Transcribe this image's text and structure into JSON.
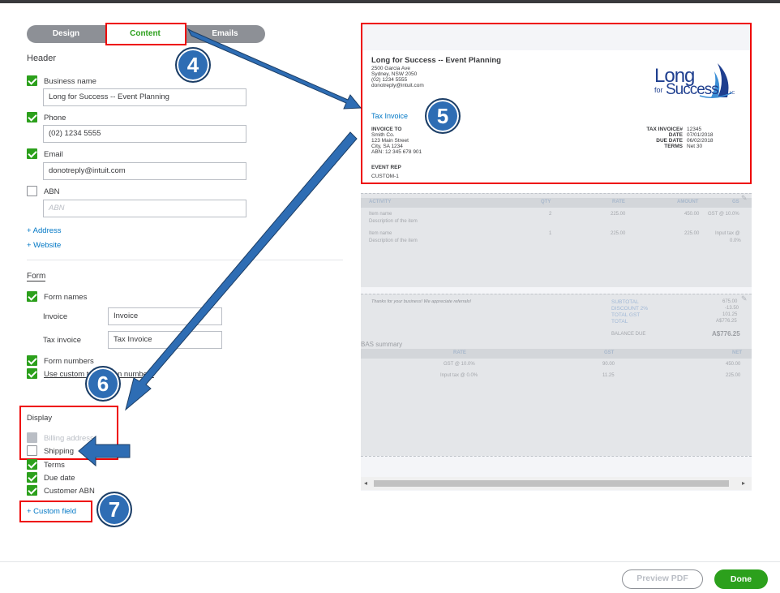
{
  "tabs": {
    "design": "Design",
    "content": "Content",
    "emails": "Emails"
  },
  "header_section": {
    "title": "Header",
    "business_name_label": "Business name",
    "business_name_value": "Long for Success --  Event Planning",
    "phone_label": "Phone",
    "phone_value": "(02) 1234 5555",
    "email_label": "Email",
    "email_value": "donotreply@intuit.com",
    "abn_label": "ABN",
    "abn_placeholder": "ABN",
    "add_address": "+ Address",
    "add_website": "+ Website"
  },
  "form_section": {
    "title": "Form",
    "form_names_label": "Form names",
    "invoice_label": "Invoice",
    "invoice_value": "Invoice",
    "tax_invoice_label": "Tax invoice",
    "tax_invoice_value": "Tax Invoice",
    "form_numbers_label": "Form numbers",
    "custom_numbers_label": "Use custom tr",
    "custom_numbers_label_tail": "n numbers"
  },
  "display_section": {
    "title": "Display",
    "billing_address": "Billing address",
    "shipping": "Shipping",
    "terms": "Terms",
    "due_date": "Due date",
    "customer_abn": "Customer ABN",
    "custom_field": "+ Custom field"
  },
  "callouts": [
    "4",
    "5",
    "6",
    "7"
  ],
  "preview": {
    "company": "Long for Success -- Event Planning",
    "address1": "2500 Garcia Ave",
    "address2": "Sydney, NSW 2050",
    "phone": "(02) 1234 5555",
    "email": "donotreply@intuit.com",
    "logo_long": "Long",
    "logo_for": "for",
    "logo_success": "Success",
    "logo_llc": "LLC",
    "doc_title": "Tax Invoice",
    "invoice_to": "INVOICE TO",
    "to_lines": [
      "Smith Co.",
      "123 Main Street",
      "City, SA 1234",
      "ABN: 12 345 678 901"
    ],
    "meta_labels": [
      "TAX INVOICE#",
      "DATE",
      "DUE DATE",
      "TERMS"
    ],
    "meta_values": [
      "12345",
      "07/01/2018",
      "06/02/2018",
      "Net 30"
    ],
    "event_rep": "EVENT REP",
    "custom1": "CUSTOM-1",
    "table_headers": [
      "ACTIVITY",
      "QTY",
      "RATE",
      "AMOUNT",
      "GS"
    ],
    "row1": {
      "name": "Item name",
      "desc": "Description of the item",
      "qty": "2",
      "rate": "225.00",
      "amount": "450.00",
      "gst": "GST @ 10.0%"
    },
    "row2": {
      "name": "Item name",
      "desc": "Description of the item",
      "qty": "1",
      "rate": "225.00",
      "amount": "225.00",
      "gst": "Input tax @",
      "gst2": "0.0%"
    },
    "thanks": "Thanks for your business! We appreciate referrals!",
    "totals_labels": [
      "SUBTOTAL",
      "DISCOUNT 2%",
      "TOTAL GST",
      "TOTAL"
    ],
    "totals_values": [
      "675.00",
      "-13.50",
      "101.25",
      "A$776.25"
    ],
    "balance_label": "BALANCE DUE",
    "balance_value": "A$776.25",
    "bas_title": "BAS summary",
    "bas_headers": [
      "RATE",
      "GST",
      "NET"
    ],
    "bas_row1": [
      "GST @ 10.0%",
      "90.00",
      "450.00"
    ],
    "bas_row2": [
      "Input tax @ 0.0%",
      "11.25",
      "225.00"
    ]
  },
  "footer": {
    "preview_pdf": "Preview PDF",
    "done": "Done"
  },
  "colors": {
    "green": "#2ca01c",
    "link": "#0077c5",
    "red": "#e00000",
    "callout": "#2e6db4"
  }
}
